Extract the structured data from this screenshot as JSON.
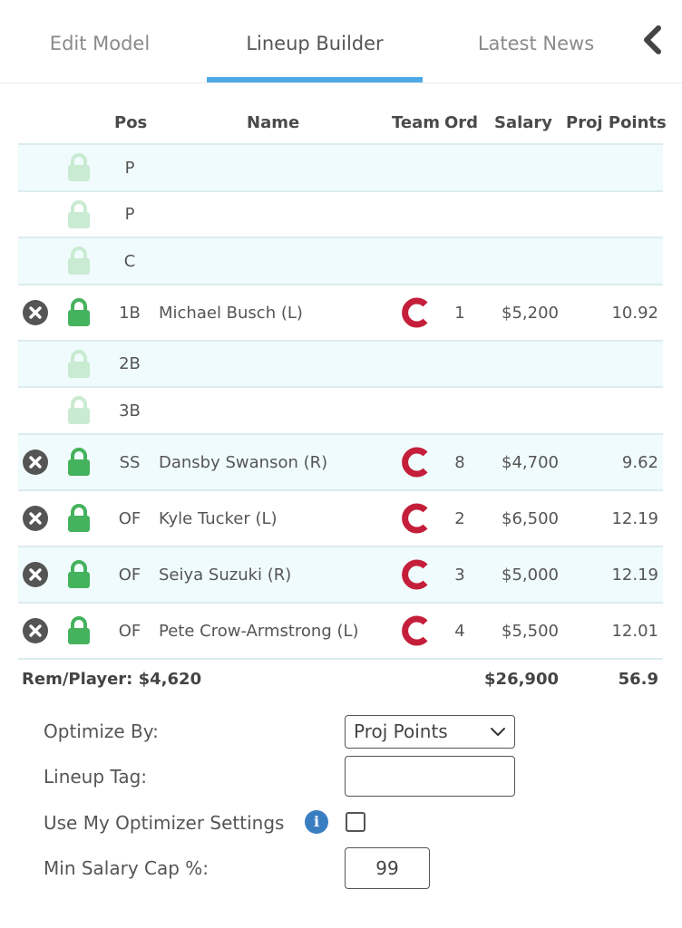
{
  "tabs": [
    {
      "label": "Edit Model"
    },
    {
      "label": "Lineup Builder"
    },
    {
      "label": "Latest News"
    }
  ],
  "table": {
    "headers": {
      "pos": "Pos",
      "name": "Name",
      "team": "Team",
      "ord": "Ord",
      "salary": "Salary",
      "proj": "Proj Points"
    },
    "rows": [
      {
        "pos": "P",
        "name": "",
        "ord": "",
        "salary": "",
        "proj": "",
        "filled": false
      },
      {
        "pos": "P",
        "name": "",
        "ord": "",
        "salary": "",
        "proj": "",
        "filled": false
      },
      {
        "pos": "C",
        "name": "",
        "ord": "",
        "salary": "",
        "proj": "",
        "filled": false
      },
      {
        "pos": "1B",
        "name": "Michael Busch (L)",
        "ord": "1",
        "salary": "$5,200",
        "proj": "10.92",
        "filled": true
      },
      {
        "pos": "2B",
        "name": "",
        "ord": "",
        "salary": "",
        "proj": "",
        "filled": false
      },
      {
        "pos": "3B",
        "name": "",
        "ord": "",
        "salary": "",
        "proj": "",
        "filled": false
      },
      {
        "pos": "SS",
        "name": "Dansby Swanson (R)",
        "ord": "8",
        "salary": "$4,700",
        "proj": "9.62",
        "filled": true
      },
      {
        "pos": "OF",
        "name": "Kyle Tucker (L)",
        "ord": "2",
        "salary": "$6,500",
        "proj": "12.19",
        "filled": true
      },
      {
        "pos": "OF",
        "name": "Seiya Suzuki (R)",
        "ord": "3",
        "salary": "$5,000",
        "proj": "12.19",
        "filled": true
      },
      {
        "pos": "OF",
        "name": "Pete Crow-Armstrong (L)",
        "ord": "4",
        "salary": "$5,500",
        "proj": "12.01",
        "filled": true
      }
    ]
  },
  "totals": {
    "rem_player": "Rem/Player: $4,620",
    "salary": "$26,900",
    "proj": "56.9"
  },
  "form": {
    "optimize_by_label": "Optimize By:",
    "optimize_by_value": "Proj Points",
    "lineup_tag_label": "Lineup Tag:",
    "lineup_tag_value": "",
    "use_settings_label": "Use My Optimizer Settings",
    "use_settings_checked": false,
    "min_salary_label": "Min Salary Cap %:",
    "min_salary_value": "99"
  },
  "icons": {
    "remove": "x-circle-icon",
    "lock": "lock-icon",
    "team_logo": "cubs-c-logo-icon",
    "info": "info-icon",
    "collapse": "chevron-left-icon",
    "dropdown": "chevron-down-icon"
  },
  "colors": {
    "active_tab_underline": "#4fa9e6",
    "lock_active": "#45b25d",
    "lock_inactive": "#c9ebd1",
    "team_logo": "#c41e3a",
    "row_alt": "#f0fbfd",
    "info": "#3a7ec2"
  }
}
